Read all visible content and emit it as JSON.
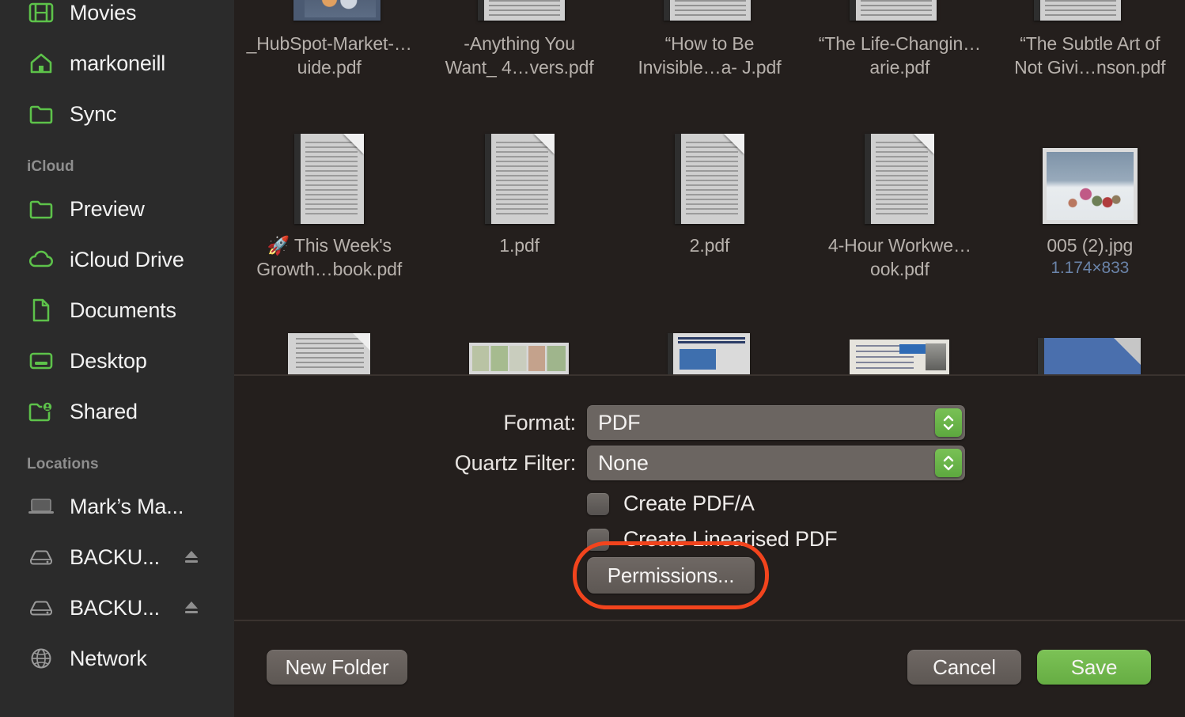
{
  "sidebar": {
    "top_items": [
      {
        "label": "Movies",
        "icon": "movies-icon"
      },
      {
        "label": "markoneill",
        "icon": "home-icon"
      },
      {
        "label": "Sync",
        "icon": "folder-icon"
      }
    ],
    "icloud_header": "iCloud",
    "icloud_items": [
      {
        "label": "Preview",
        "icon": "folder-icon"
      },
      {
        "label": "iCloud Drive",
        "icon": "cloud-icon"
      },
      {
        "label": "Documents",
        "icon": "document-icon"
      },
      {
        "label": "Desktop",
        "icon": "desktop-icon"
      },
      {
        "label": "Shared",
        "icon": "shared-folder-icon"
      }
    ],
    "locations_header": "Locations",
    "locations_items": [
      {
        "label": "Mark’s Ma...",
        "icon": "laptop-icon",
        "eject": false
      },
      {
        "label": "BACKU...",
        "icon": "harddisk-icon",
        "eject": true
      },
      {
        "label": "BACKU...",
        "icon": "harddisk-icon",
        "eject": true
      },
      {
        "label": "Network",
        "icon": "globe-icon",
        "eject": false
      }
    ]
  },
  "browser": {
    "row1": [
      {
        "name": "_HubSpot-Market-…uide.pdf",
        "thumb": "illustration"
      },
      {
        "name": "-Anything You Want_ 4…vers.pdf",
        "thumb": "pdf"
      },
      {
        "name": "“How to Be Invisible…a- J.pdf",
        "thumb": "pdf"
      },
      {
        "name": "“The Life-Changin…arie.pdf",
        "thumb": "pdf"
      },
      {
        "name": "“The Subtle Art of Not Givi…nson.pdf",
        "thumb": "pdf"
      }
    ],
    "row2": [
      {
        "name": "🚀 This Week's Growth…book.pdf",
        "thumb": "pdf",
        "dims": ""
      },
      {
        "name": "1.pdf",
        "thumb": "pdf",
        "dims": ""
      },
      {
        "name": "2.pdf",
        "thumb": "pdf",
        "dims": ""
      },
      {
        "name": "4-Hour Workwe…ook.pdf",
        "thumb": "pdf",
        "dims": ""
      },
      {
        "name": "005 (2).jpg",
        "thumb": "image",
        "dims": "1.174×833"
      }
    ],
    "row3_thumb_types": [
      "document",
      "stamps",
      "webdoc",
      "letter",
      "bluefile"
    ]
  },
  "panel": {
    "format": {
      "label": "Format:",
      "value": "PDF"
    },
    "quartz_filter": {
      "label": "Quartz Filter:",
      "value": "None"
    },
    "checkboxes": [
      {
        "label": "Create PDF/A",
        "checked": false
      },
      {
        "label": "Create Linearised PDF",
        "checked": false
      }
    ],
    "permissions_label": "Permissions...",
    "highlight_color": "#f2441d"
  },
  "buttons": {
    "new_folder": "New Folder",
    "cancel": "Cancel",
    "save": "Save"
  }
}
